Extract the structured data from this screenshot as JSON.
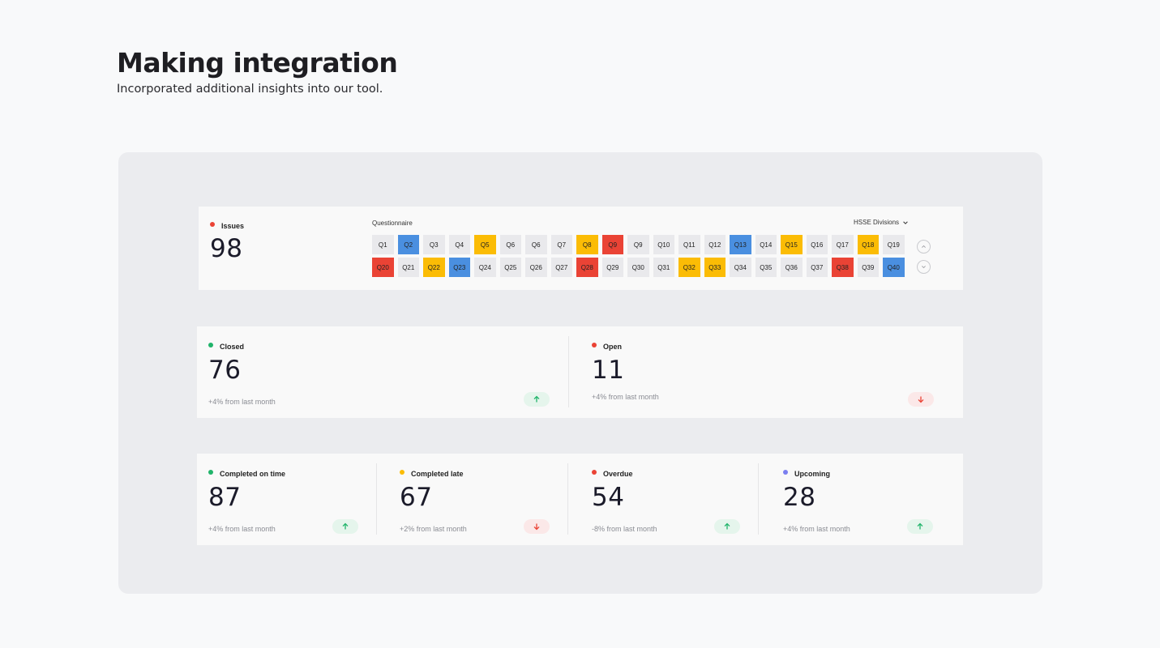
{
  "page": {
    "title": "Making integration",
    "subtitle": "Incorporated additional insights into our tool."
  },
  "colors": {
    "green": "#20b46a",
    "red": "#ea4335",
    "yellow": "#fbbc05",
    "purple": "#7b7ff0",
    "blue": "#4a8fe0",
    "neutral": "#e9e9ec"
  },
  "issues": {
    "label": "Issues",
    "value": "98",
    "questionnaire_label": "Questionnaire",
    "filter_label": "HSSE Divisions",
    "questions_row1": [
      {
        "label": "Q1",
        "status": "neutral"
      },
      {
        "label": "Q2",
        "status": "blue"
      },
      {
        "label": "Q3",
        "status": "neutral"
      },
      {
        "label": "Q4",
        "status": "neutral"
      },
      {
        "label": "Q5",
        "status": "yellow"
      },
      {
        "label": "Q6",
        "status": "neutral"
      },
      {
        "label": "Q6",
        "status": "neutral"
      },
      {
        "label": "Q7",
        "status": "neutral"
      },
      {
        "label": "Q8",
        "status": "yellow"
      },
      {
        "label": "Q9",
        "status": "red"
      },
      {
        "label": "Q9",
        "status": "neutral"
      },
      {
        "label": "Q10",
        "status": "neutral"
      },
      {
        "label": "Q11",
        "status": "neutral"
      },
      {
        "label": "Q12",
        "status": "neutral"
      },
      {
        "label": "Q13",
        "status": "blue"
      },
      {
        "label": "Q14",
        "status": "neutral"
      },
      {
        "label": "Q15",
        "status": "yellow"
      },
      {
        "label": "Q16",
        "status": "neutral"
      },
      {
        "label": "Q17",
        "status": "neutral"
      },
      {
        "label": "Q18",
        "status": "yellow"
      },
      {
        "label": "Q19",
        "status": "neutral"
      }
    ],
    "questions_row2": [
      {
        "label": "Q20",
        "status": "red"
      },
      {
        "label": "Q21",
        "status": "neutral"
      },
      {
        "label": "Q22",
        "status": "yellow"
      },
      {
        "label": "Q23",
        "status": "blue"
      },
      {
        "label": "Q24",
        "status": "neutral"
      },
      {
        "label": "Q25",
        "status": "neutral"
      },
      {
        "label": "Q26",
        "status": "neutral"
      },
      {
        "label": "Q27",
        "status": "neutral"
      },
      {
        "label": "Q28",
        "status": "red"
      },
      {
        "label": "Q29",
        "status": "neutral"
      },
      {
        "label": "Q30",
        "status": "neutral"
      },
      {
        "label": "Q31",
        "status": "neutral"
      },
      {
        "label": "Q32",
        "status": "yellow"
      },
      {
        "label": "Q33",
        "status": "yellow"
      },
      {
        "label": "Q34",
        "status": "neutral"
      },
      {
        "label": "Q35",
        "status": "neutral"
      },
      {
        "label": "Q36",
        "status": "neutral"
      },
      {
        "label": "Q37",
        "status": "neutral"
      },
      {
        "label": "Q38",
        "status": "red"
      },
      {
        "label": "Q39",
        "status": "neutral"
      },
      {
        "label": "Q40",
        "status": "blue"
      }
    ],
    "nav_up_icon": "chevron-up-icon",
    "nav_down_icon": "chevron-down-icon"
  },
  "status_row": {
    "closed": {
      "label": "Closed",
      "value": "76",
      "delta": "+4% from last month",
      "trend": "up"
    },
    "open": {
      "label": "Open",
      "value": "11",
      "delta": "+4% from last month",
      "trend": "down"
    }
  },
  "timing_row": {
    "completed_on_time": {
      "label": "Completed on time",
      "value": "87",
      "delta": "+4% from last month",
      "trend": "up"
    },
    "completed_late": {
      "label": "Completed late",
      "value": "67",
      "delta": "+2% from last month",
      "trend": "down"
    },
    "overdue": {
      "label": "Overdue",
      "value": "54",
      "delta": "-8% from last month",
      "trend": "up"
    },
    "upcoming": {
      "label": "Upcoming",
      "value": "28",
      "delta": "+4% from last month",
      "trend": "up"
    }
  }
}
